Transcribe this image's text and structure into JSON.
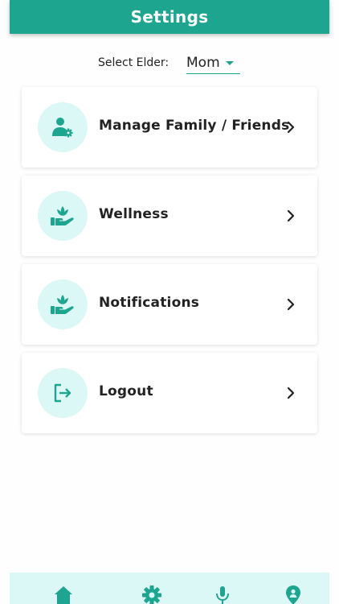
{
  "header": {
    "title": "Settings"
  },
  "elder_select": {
    "label": "Select Elder:",
    "value": "Mom"
  },
  "menu": [
    {
      "label": "Manage Family / Friends",
      "icon": "user-gear-icon"
    },
    {
      "label": "Wellness",
      "icon": "hand-lotus-icon"
    },
    {
      "label": "Notifications",
      "icon": "hand-lotus-icon"
    },
    {
      "label": "Logout",
      "icon": "logout-icon"
    }
  ],
  "bottom_nav": [
    {
      "icon": "home-icon"
    },
    {
      "icon": "gear-icon"
    },
    {
      "icon": "microphone-icon"
    },
    {
      "icon": "location-pin-icon"
    }
  ],
  "colors": {
    "accent": "#1ea58f",
    "icon_bg": "#dcf8f6",
    "text": "#222222"
  }
}
